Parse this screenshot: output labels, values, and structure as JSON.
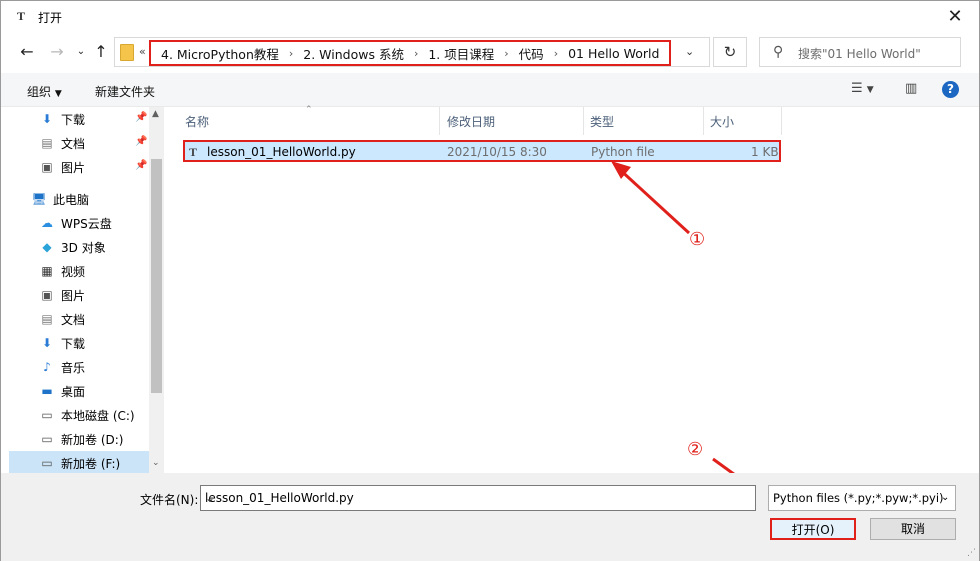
{
  "title": "打开",
  "address": {
    "overflow": "«",
    "crumbs": [
      "4. MicroPython教程",
      "2. Windows 系统",
      "1. 项目课程",
      "代码",
      "01 Hello World"
    ],
    "search_placeholder": "搜索\"01 Hello World\""
  },
  "toolbar": {
    "organize": "组织",
    "new_folder": "新建文件夹"
  },
  "sidebar": {
    "items": [
      {
        "label": "下载",
        "pinned": true
      },
      {
        "label": "文档",
        "pinned": true
      },
      {
        "label": "图片",
        "pinned": true
      },
      {
        "label": "此电脑"
      },
      {
        "label": "WPS云盘"
      },
      {
        "label": "3D 对象"
      },
      {
        "label": "视频"
      },
      {
        "label": "图片"
      },
      {
        "label": "文档"
      },
      {
        "label": "下载"
      },
      {
        "label": "音乐"
      },
      {
        "label": "桌面"
      },
      {
        "label": "本地磁盘 (C:)"
      },
      {
        "label": "新加卷 (D:)"
      },
      {
        "label": "新加卷 (F:)",
        "selected": true
      }
    ]
  },
  "columns": {
    "name": "名称",
    "date": "修改日期",
    "type": "类型",
    "size": "大小"
  },
  "files": [
    {
      "name": "lesson_01_HelloWorld.py",
      "date": "2021/10/15 8:30",
      "type": "Python file",
      "size": "1 KB"
    }
  ],
  "annotations": {
    "one": "①",
    "two": "②"
  },
  "bottom": {
    "filename_label": "文件名(N):",
    "filename_value": "lesson_01_HelloWorld.py",
    "filter": "Python files (*.py;*.pyw;*.pyi)",
    "open": "打开(O)",
    "cancel": "取消"
  },
  "colors": {
    "highlight": "#e0201b",
    "selection": "#cce8ff"
  }
}
